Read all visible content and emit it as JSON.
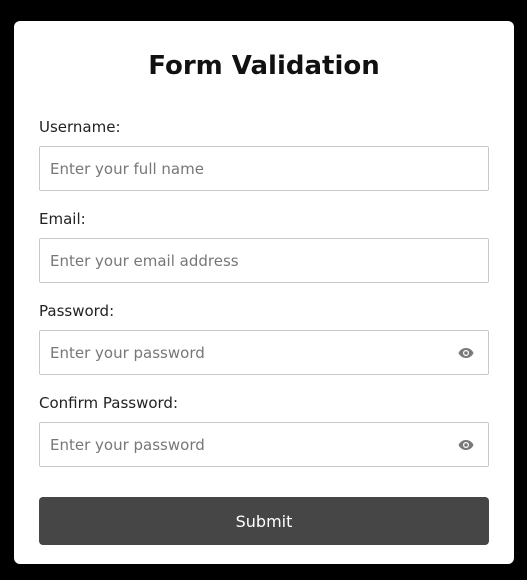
{
  "form": {
    "title": "Form Validation",
    "fields": [
      {
        "label": "Username:",
        "placeholder": "Enter your full name",
        "value": ""
      },
      {
        "label": "Email:",
        "placeholder": "Enter your email address",
        "value": ""
      },
      {
        "label": "Password:",
        "placeholder": "Enter your password",
        "value": "",
        "icon": "eye-icon"
      },
      {
        "label": "Confirm Password:",
        "placeholder": "Enter your password",
        "value": "",
        "icon": "eye-icon"
      }
    ],
    "submit_label": "Submit"
  },
  "colors": {
    "background": "#000000",
    "card": "#ffffff",
    "button": "#464646",
    "button_text": "#ffffff",
    "input_border": "#c8c8c8"
  }
}
